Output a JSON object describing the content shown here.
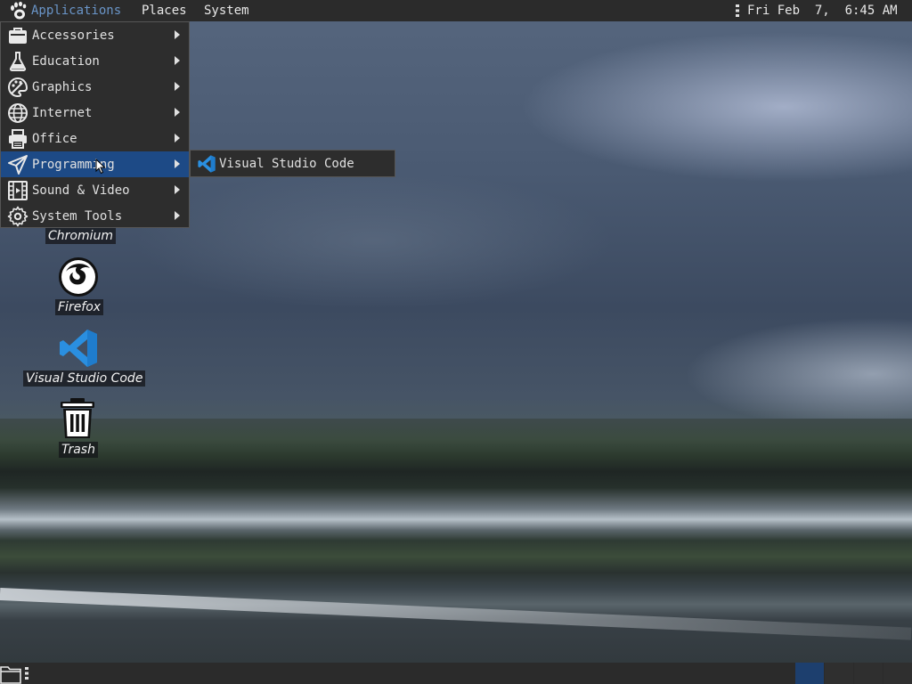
{
  "top_panel": {
    "menus": [
      "Applications",
      "Places",
      "System"
    ],
    "clock": "Fri Feb  7,  6:45 AM"
  },
  "applications_menu": {
    "items": [
      {
        "label": "Accessories",
        "icon": "briefcase-icon"
      },
      {
        "label": "Education",
        "icon": "flask-icon"
      },
      {
        "label": "Graphics",
        "icon": "palette-icon"
      },
      {
        "label": "Internet",
        "icon": "globe-icon"
      },
      {
        "label": "Office",
        "icon": "printer-icon"
      },
      {
        "label": "Programming",
        "icon": "paper-plane-icon"
      },
      {
        "label": "Sound & Video",
        "icon": "film-icon"
      },
      {
        "label": "System Tools",
        "icon": "gear-icon"
      }
    ],
    "highlighted": "Programming"
  },
  "programming_submenu": {
    "items": [
      {
        "label": "Visual Studio Code",
        "icon": "vscode-icon"
      }
    ]
  },
  "desktop": {
    "icons": [
      {
        "label": "Chromium",
        "icon": "chromium-icon"
      },
      {
        "label": "Firefox",
        "icon": "firefox-icon"
      },
      {
        "label": "Visual Studio Code",
        "icon": "vscode-icon"
      },
      {
        "label": "Trash",
        "icon": "trash-icon"
      }
    ]
  },
  "colors": {
    "panel": "#2b2b2b",
    "menu_bg": "#2d2d2d",
    "highlight": "#1d4a86",
    "vscode_blue": "#2a8fe0"
  }
}
